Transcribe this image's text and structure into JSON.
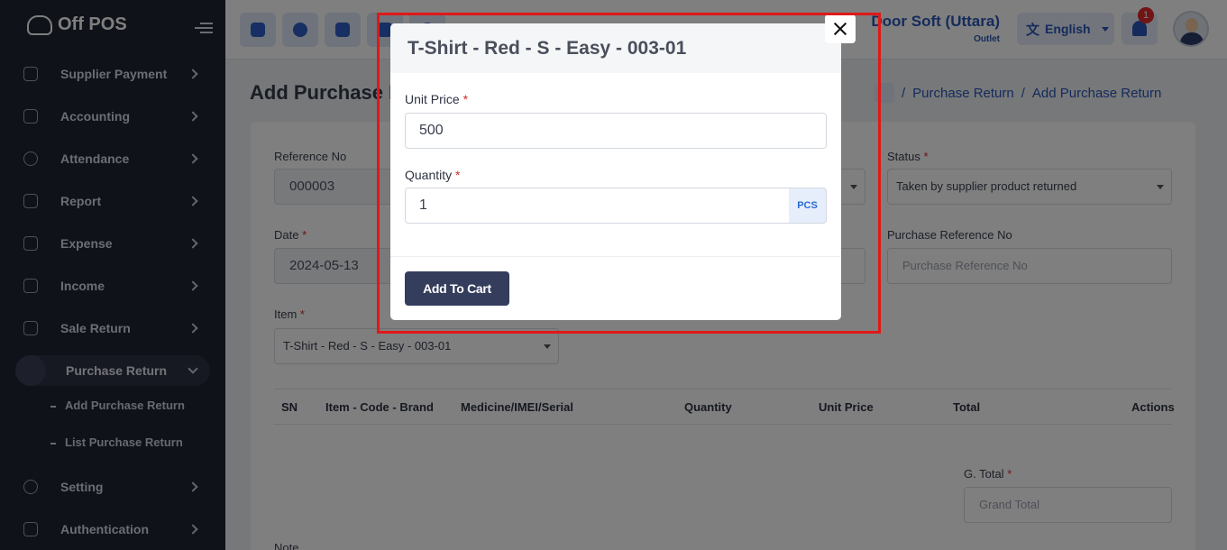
{
  "app": {
    "brand": "Off POS"
  },
  "sidebar": {
    "items": [
      {
        "label": "Supplier Payment",
        "icon": "supplier-payment-icon"
      },
      {
        "label": "Accounting",
        "icon": "accounting-icon"
      },
      {
        "label": "Attendance",
        "icon": "attendance-icon"
      },
      {
        "label": "Report",
        "icon": "report-icon"
      },
      {
        "label": "Expense",
        "icon": "expense-icon"
      },
      {
        "label": "Income",
        "icon": "income-icon"
      },
      {
        "label": "Sale Return",
        "icon": "sale-return-icon"
      },
      {
        "label": "Purchase Return",
        "icon": "purchase-return-icon",
        "active": true
      },
      {
        "label": "Setting",
        "icon": "setting-icon"
      },
      {
        "label": "Authentication",
        "icon": "authentication-icon"
      }
    ],
    "submenu": [
      {
        "label": "Add Purchase Return"
      },
      {
        "label": "List Purchase Return"
      }
    ]
  },
  "topbar": {
    "outlet_name": "Door Soft (Uttara)",
    "outlet_sub": "Outlet",
    "language": "English",
    "notification_count": "1"
  },
  "main": {
    "page_title": "Add Purchase Return",
    "breadcrumb": [
      "Purchase Return",
      "Add Purchase Return"
    ],
    "form": {
      "reference_label": "Reference No",
      "reference_value": "000003",
      "date_label": "Date",
      "date_value": "2024-05-13",
      "item_label": "Item",
      "item_value": "T-Shirt - Red - S - Easy - 003-01",
      "status_label": "Status",
      "status_value": "Taken by supplier product returned",
      "purchase_ref_label": "Purchase Reference No",
      "purchase_ref_placeholder": "Purchase Reference No",
      "gtotal_label": "G. Total",
      "gtotal_placeholder": "Grand Total",
      "note_label": "Note"
    },
    "table_headers": [
      "SN",
      "Item - Code - Brand",
      "Medicine/IMEI/Serial",
      "Quantity",
      "Unit Price",
      "Total",
      "Actions"
    ]
  },
  "modal": {
    "title": "T-Shirt - Red - S - Easy - 003-01",
    "unit_price_label": "Unit Price",
    "unit_price_value": "500",
    "quantity_label": "Quantity",
    "quantity_value": "1",
    "unit": "PCS",
    "add_button": "Add To Cart",
    "required_mark": "*"
  },
  "colors": {
    "highlight": "#e01818",
    "primary": "#2a56b8",
    "sidebar_bg": "#1f2433"
  }
}
